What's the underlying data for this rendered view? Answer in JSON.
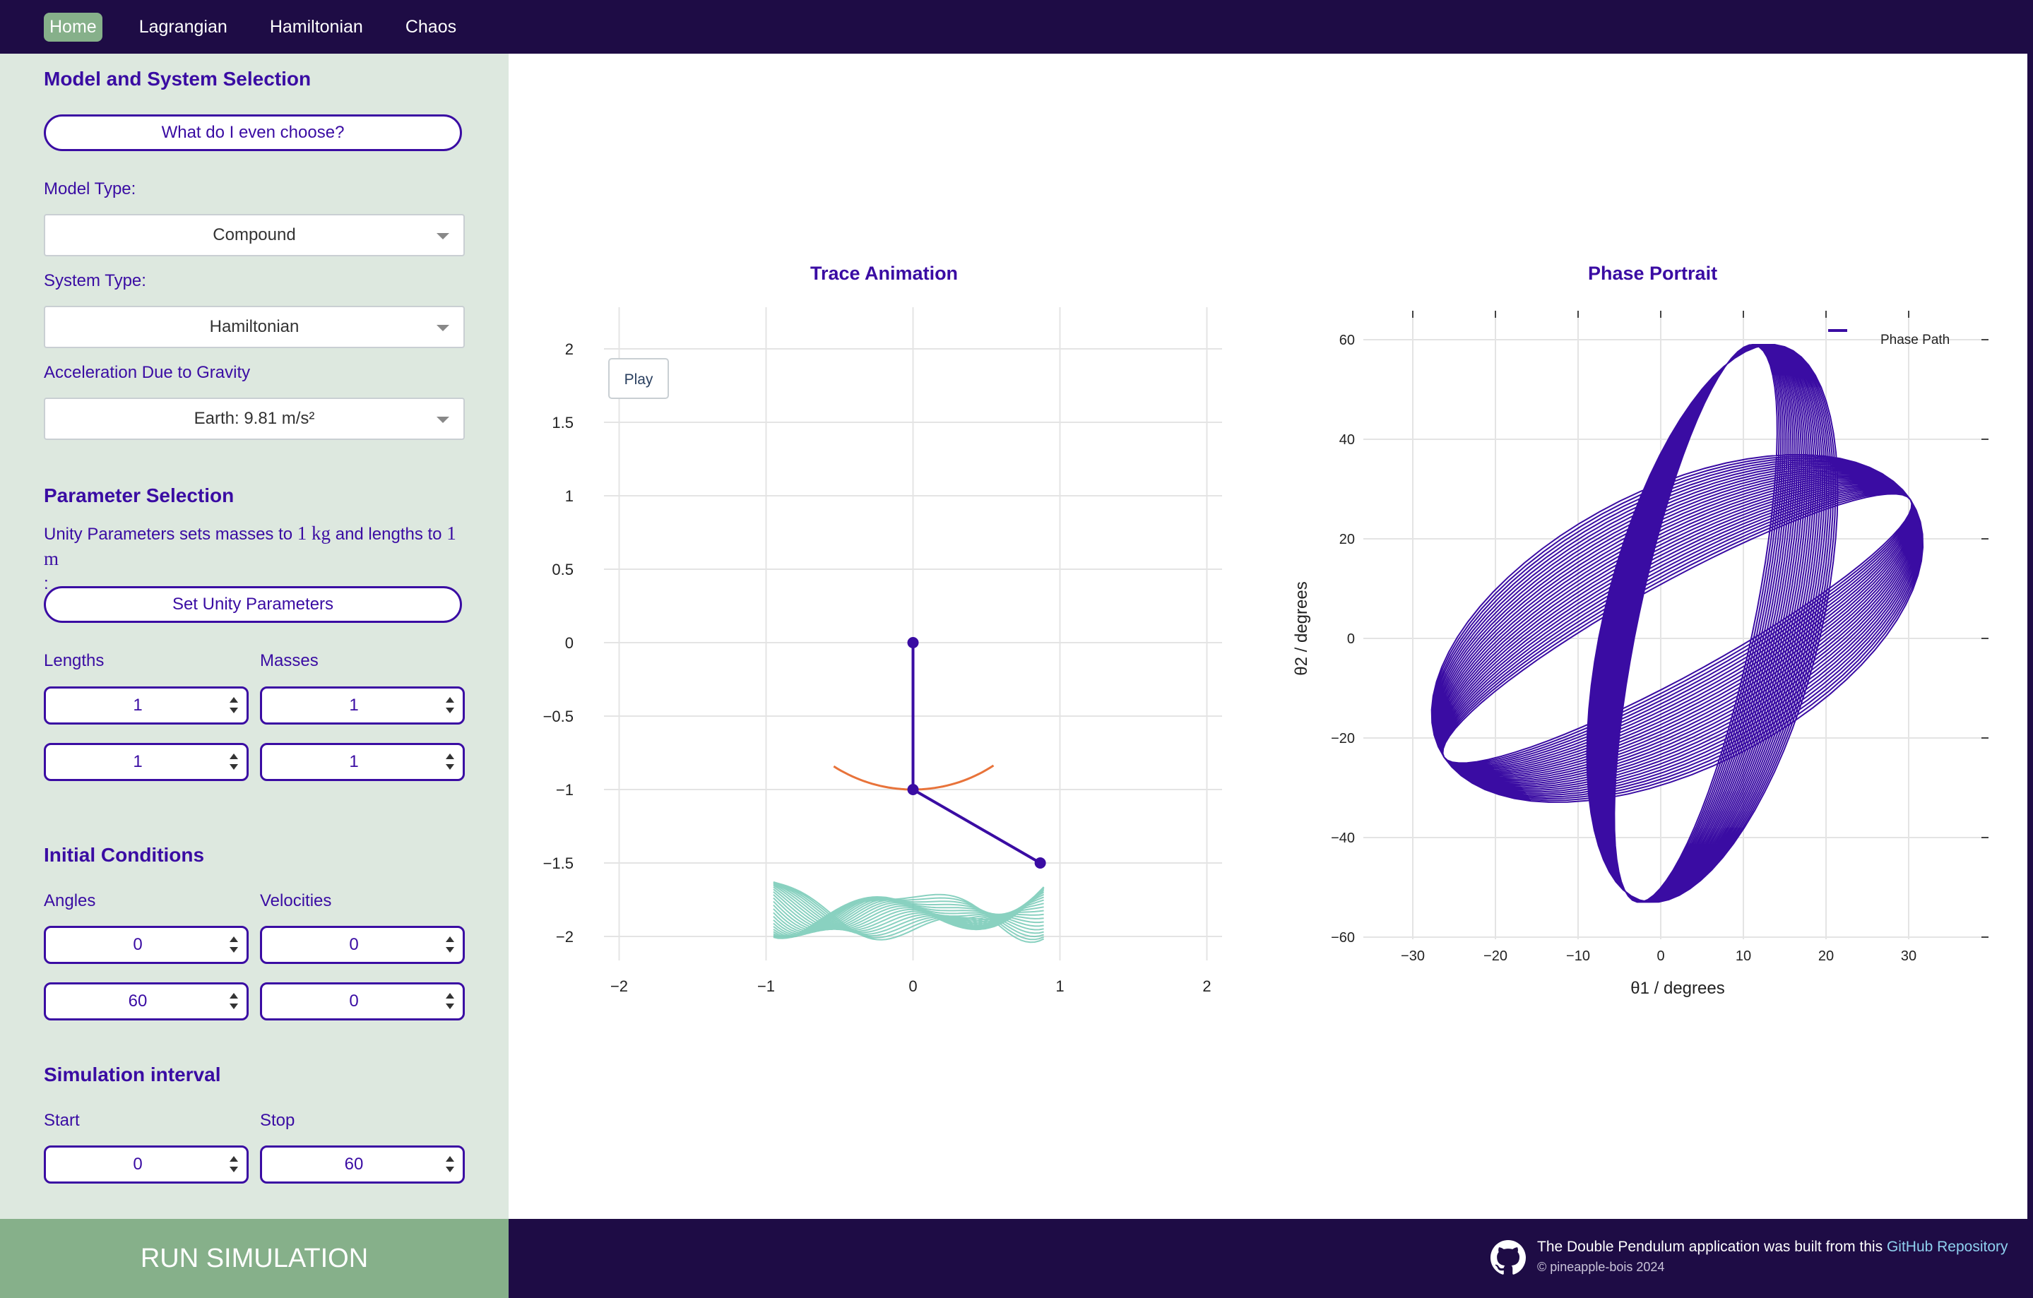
{
  "nav": {
    "items": [
      {
        "label": "Home",
        "active": true
      },
      {
        "label": "Lagrangian",
        "active": false
      },
      {
        "label": "Hamiltonian",
        "active": false
      },
      {
        "label": "Chaos",
        "active": false
      }
    ]
  },
  "sidebar": {
    "model_section_title": "Model and System Selection",
    "choose_help_button": "What do I even choose?",
    "model_type_label": "Model Type:",
    "model_type_value": "Compound",
    "system_type_label": "System Type:",
    "system_type_value": "Hamiltonian",
    "gravity_label": "Acceleration Due to Gravity",
    "gravity_value": "Earth: 9.81 m/s²",
    "param_section_title": "Parameter Selection",
    "unity_text_1": "Unity Parameters sets masses to",
    "unity_kg": "1 kg",
    "unity_text_2": "and lengths to",
    "unity_m": "1 m",
    "unity_colon": ":",
    "unity_button": "Set Unity Parameters",
    "lengths_label": "Lengths",
    "masses_label": "Masses",
    "length1": "1",
    "length2": "1",
    "mass1": "1",
    "mass2": "1",
    "ic_section_title": "Initial Conditions",
    "angles_label": "Angles",
    "velocities_label": "Velocities",
    "angle1": "0",
    "angle2": "60",
    "velocity1": "0",
    "velocity2": "0",
    "interval_section_title": "Simulation interval",
    "start_label": "Start",
    "stop_label": "Stop",
    "start_value": "0",
    "stop_value": "60",
    "run_button": "RUN SIMULATION"
  },
  "footer": {
    "text": "The Double Pendulum application was built from this",
    "link": "GitHub Repository",
    "copyright": "© pineapple-bois 2024"
  },
  "colors": {
    "nav_bg": "#1e0c45",
    "accent": "#3a0ca3",
    "sidebar_bg": "#dde8df",
    "run_bg": "#86b08a",
    "trace_color": "#6cc5b0",
    "bob_arc_color": "#e8733a"
  },
  "chart_data": [
    {
      "type": "line",
      "title": "Trace Animation",
      "play_button": "Play",
      "xlim": [
        -2.2,
        2.2
      ],
      "ylim": [
        -2.2,
        2.2
      ],
      "xticks": [
        "−2",
        "−1",
        "0",
        "1",
        "2"
      ],
      "yticks": [
        "2",
        "1.5",
        "1",
        "0.5",
        "0",
        "−0.5",
        "−1",
        "−1.5",
        "−2"
      ],
      "grid": true,
      "pendulum": {
        "pivot": [
          0,
          0
        ],
        "bob1": [
          0,
          -1
        ],
        "bob2": [
          0.866,
          -1.5
        ]
      }
    },
    {
      "type": "line",
      "title": "Phase Portrait",
      "xlabel": "θ1 / degrees",
      "ylabel": "θ2 / degrees",
      "xlim": [
        -35,
        40
      ],
      "ylim": [
        -62,
        62
      ],
      "xticks": [
        "−30",
        "−20",
        "−10",
        "0",
        "10",
        "20",
        "30"
      ],
      "yticks": [
        "60",
        "40",
        "20",
        "0",
        "−20",
        "−40",
        "−60"
      ],
      "legend": "top-right",
      "series": [
        {
          "name": "Phase Path",
          "color": "#3a0ca3"
        }
      ],
      "grid": true
    }
  ]
}
